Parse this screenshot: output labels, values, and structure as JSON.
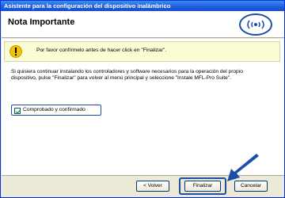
{
  "window": {
    "title": "Asistente para la configuración del dispositivo inalámbrico"
  },
  "header": {
    "title": "Nota Importante",
    "logo_icon": "wireless-logo-icon"
  },
  "warning": {
    "icon": "warning-icon",
    "text": "Por favor confírmelo antes de hacer click en \"Finalizar\"."
  },
  "instructions": {
    "text": "Si quisiera continuar instalando los controladores y software necesarios para la operación del propio dispositivo, pulse \"Finalizar\" para volver al menú principal y seleccione \"Instale MFL-Pro Suite\"."
  },
  "confirmation": {
    "label": "Comprobado y confirmado",
    "checked": true
  },
  "buttons": {
    "back_label": "< Volver",
    "finish_label": "Finalizar",
    "cancel_label": "Cancelar"
  },
  "colors": {
    "title_bar": "#1d5ddb",
    "highlight": "#1d4fa8",
    "warning_bg": "#fcfcd4"
  }
}
